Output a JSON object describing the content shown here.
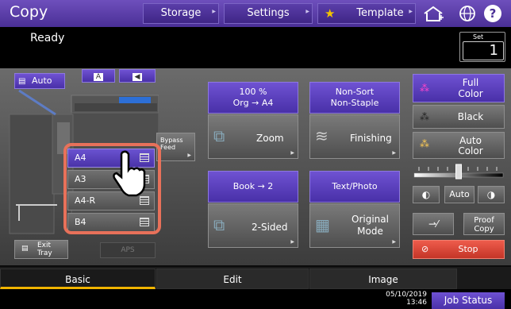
{
  "header": {
    "title": "Copy",
    "storage": "Storage",
    "settings": "Settings",
    "template": "Template"
  },
  "status": {
    "text": "Ready",
    "set_label": "Set",
    "set_value": "1"
  },
  "color_mode": {
    "auto": "Auto"
  },
  "trays": [
    {
      "label": "A4"
    },
    {
      "label": "A3"
    },
    {
      "label": "A4-R"
    },
    {
      "label": "B4"
    }
  ],
  "bypass": {
    "label": "Bypass\nFeed"
  },
  "exit_tray": {
    "label": "Exit\nTray"
  },
  "aps": {
    "label": "APS"
  },
  "zoom": {
    "top_line1": "100 %",
    "top_line2": "Org  →  A4",
    "label": "Zoom"
  },
  "finishing": {
    "top_line1": "Non-Sort",
    "top_line2": "Non-Staple",
    "label": "Finishing"
  },
  "sided": {
    "top": "Book → 2",
    "label": "2-Sided"
  },
  "original": {
    "top": "Text/Photo",
    "label": "Original\nMode"
  },
  "color": {
    "full": "Full\nColor",
    "black": "Black",
    "auto": "Auto\nColor"
  },
  "density": {
    "auto": "Auto",
    "level": 0.5
  },
  "proof": {
    "label": "Proof\nCopy"
  },
  "stop": {
    "label": "Stop"
  },
  "tabs": [
    "Basic",
    "Edit",
    "Image"
  ],
  "footer": {
    "date": "05/10/2019",
    "time": "13:46",
    "job_status": "Job Status"
  }
}
